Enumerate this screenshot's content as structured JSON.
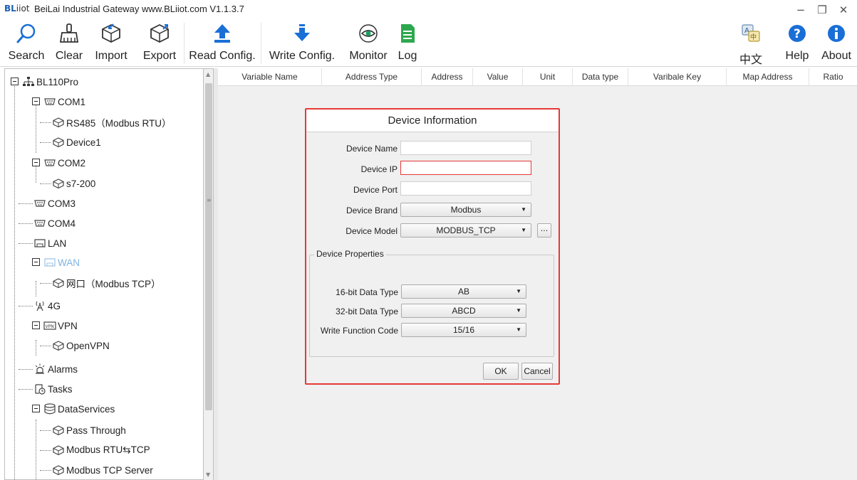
{
  "window": {
    "logo_b": "BL",
    "logo_rest": "iiot",
    "title": "BeiLai Industrial Gateway www.BLiiot.com V1.1.3.7",
    "minimize": "−",
    "maximize": "❐",
    "close": "✕"
  },
  "toolbar": {
    "search": "Search",
    "clear": "Clear",
    "import": "Import",
    "export": "Export",
    "read_config": "Read Config.",
    "write_config": "Write Config.",
    "monitor": "Monitor",
    "log": "Log",
    "language": "中文",
    "help": "Help",
    "about": "About"
  },
  "tree": {
    "root": "BL110Pro",
    "com1": "COM1",
    "rs485": "RS485（Modbus RTU）",
    "device1": "Device1",
    "com2": "COM2",
    "s7200": "s7-200",
    "com3": "COM3",
    "com4": "COM4",
    "lan": "LAN",
    "wan": "WAN",
    "wan_port": "网口（Modbus TCP）",
    "g4": "4G",
    "vpn": "VPN",
    "openvpn": "OpenVPN",
    "alarms": "Alarms",
    "tasks": "Tasks",
    "dataservices": "DataServices",
    "pass_through": "Pass Through",
    "modbus_rtu_tcp": "Modbus RTU⇆TCP",
    "modbus_tcp_server": "Modbus TCP Server"
  },
  "grid": {
    "columns": [
      "Variable Name",
      "Address Type",
      "Address",
      "Value",
      "Unit",
      "Data type",
      "Varibale Key",
      "Map Address",
      "Ratio"
    ]
  },
  "dialog": {
    "title": "Device Information",
    "device_name_label": "Device Name",
    "device_name_value": "",
    "device_ip_label": "Device IP",
    "device_ip_value": "",
    "device_port_label": "Device Port",
    "device_port_value": "",
    "device_brand_label": "Device Brand",
    "device_brand_value": "Modbus",
    "device_model_label": "Device Model",
    "device_model_value": "MODBUS_TCP",
    "more_button": "...",
    "properties_title": "Device Properties",
    "data16_label": "16-bit Data Type",
    "data16_value": "AB",
    "data32_label": "32-bit Data Type",
    "data32_value": "ABCD",
    "write_fc_label": "Write Function Code",
    "write_fc_value": "15/16",
    "ok": "OK",
    "cancel": "Cancel"
  },
  "colors": {
    "highlight_border": "#e53935",
    "wan_text": "#7fb3e0",
    "icon_blue": "#1a6fd6"
  }
}
